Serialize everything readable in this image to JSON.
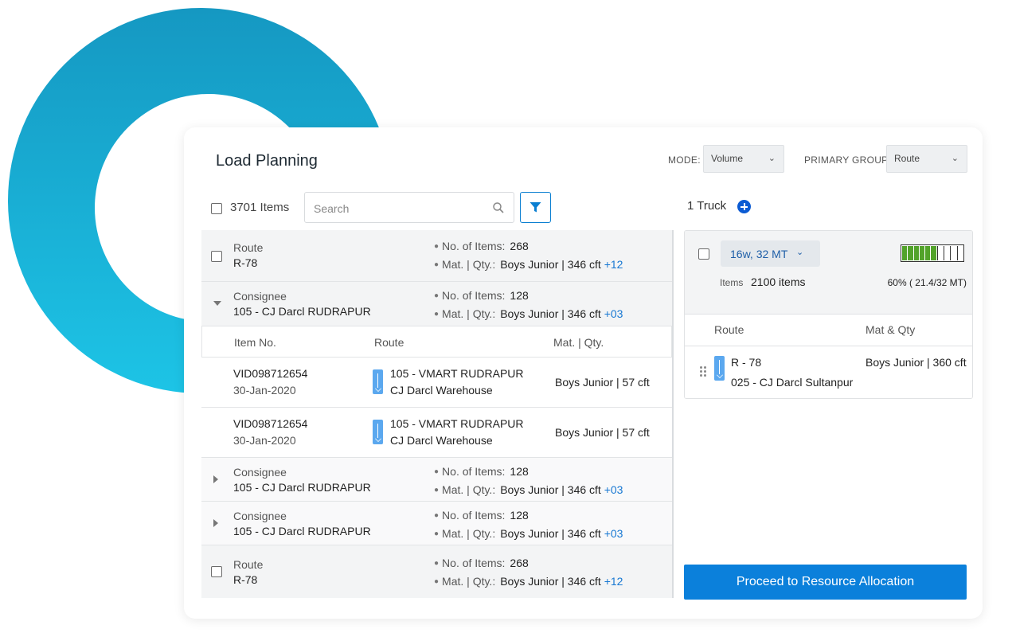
{
  "header": {
    "title": "Load Planning",
    "mode_label": "MODE:",
    "mode_value": "Volume",
    "primary_group_label": "PRIMARY GROUP:",
    "primary_group_value": "Route"
  },
  "toolbar": {
    "items_count": "3701 Items",
    "search_placeholder": "Search"
  },
  "trucks": {
    "count_label": "1 Truck"
  },
  "list": {
    "meta_items_label": "No. of Items:",
    "meta_qty_label": "Mat. | Qty.:",
    "groups": [
      {
        "label": "Route",
        "value": "R-78",
        "items": "268",
        "mat": "Boys Junior | 346 cft",
        "more": "+12"
      },
      {
        "label": "Consignee",
        "value": "105 - CJ Darcl RUDRAPUR",
        "items": "128",
        "mat": "Boys Junior | 346 cft",
        "more": "+03"
      },
      {
        "label": "Consignee",
        "value": "105 - CJ Darcl RUDRAPUR",
        "items": "128",
        "mat": "Boys Junior | 346 cft",
        "more": "+03"
      },
      {
        "label": "Consignee",
        "value": "105 - CJ Darcl RUDRAPUR",
        "items": "128",
        "mat": "Boys Junior | 346 cft",
        "more": "+03"
      },
      {
        "label": "Route",
        "value": "R-78",
        "items": "268",
        "mat": "Boys Junior | 346 cft",
        "more": "+12"
      }
    ],
    "columns": {
      "item_no": "Item No.",
      "route": "Route",
      "mat_qty": "Mat. | Qty."
    },
    "items": [
      {
        "id": "VID098712654",
        "date": "30-Jan-2020",
        "from": "105 - VMART RUDRAPUR",
        "to": "CJ Darcl Warehouse",
        "qty": "Boys Junior | 57 cft"
      },
      {
        "id": "VID098712654",
        "date": "30-Jan-2020",
        "from": "105 - VMART RUDRAPUR",
        "to": "CJ Darcl Warehouse",
        "qty": "Boys Junior | 57 cft"
      }
    ]
  },
  "truck_card": {
    "type": "16w, 32 MT",
    "items_label": "Items",
    "items_value": "2100 items",
    "capacity_text": "60% ( 21.4/32 MT)",
    "capacity_fraction": 0.6,
    "col_route": "Route",
    "col_mat_qty": "Mat & Qty",
    "row": {
      "route": "R - 78",
      "consignee": "025 - CJ Darcl Sultanpur",
      "qty": "Boys Junior | 360 cft"
    }
  },
  "actions": {
    "proceed_label": "Proceed to Resource Allocation"
  },
  "colors": {
    "accent": "#0b80db",
    "ring_top": "#1598c2",
    "ring_bottom": "#1dc4e6",
    "capacity_fill": "#52a32a",
    "link": "#1677d2"
  },
  "icons": [
    "search-icon",
    "filter-icon",
    "add-circle-icon",
    "chevron-down-icon",
    "caret-down-icon",
    "caret-right-icon",
    "arrow-down-icon",
    "drag-handle-icon"
  ]
}
